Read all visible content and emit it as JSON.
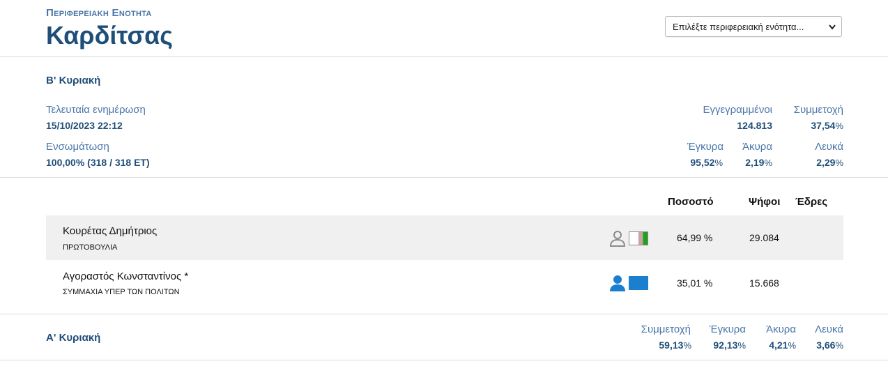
{
  "header": {
    "region_label": "Περιφερειακη Ενοτητα",
    "region_name": "Καρδίτσας",
    "select_placeholder": "Επιλέξτε περιφερειακή ενότητα..."
  },
  "round_b": {
    "title": "Β' Κυριακή",
    "last_update_label": "Τελευταία ενημέρωση",
    "last_update_value": "15/10/2023 22:12",
    "integration_label": "Ενσωμάτωση",
    "integration_value": "100,00% (318 / 318 ΕΤ)",
    "registered_label": "Εγγεγραμμένοι",
    "registered_value": "124.813",
    "turnout_label": "Συμμετοχή",
    "turnout_value": "37,54",
    "valid_label": "Έγκυρα",
    "valid_value": "95,52",
    "invalid_label": "Άκυρα",
    "invalid_value": "2,19",
    "blank_label": "Λευκά",
    "blank_value": "2,29",
    "pct_sign": "%"
  },
  "table": {
    "col_percent": "Ποσοστό",
    "col_votes": "Ψήφοι",
    "col_seats": "Έδρες",
    "rows": [
      {
        "name": "Κουρέτας Δημήτριος",
        "party": "ΠΡΩΤΟΒΟΥΛΙΑ",
        "percent": "64,99 %",
        "votes": "29.084",
        "seats": "",
        "icon_color": "#8a8a8a"
      },
      {
        "name": "Αγοραστός Κωνσταντίνος *",
        "party": "ΣΥΜΜΑΧΙΑ ΥΠΕΡ ΤΩΝ ΠΟΛΙΤΩΝ",
        "percent": "35,01 %",
        "votes": "15.668",
        "seats": "",
        "icon_color": "#1b7fd0"
      }
    ]
  },
  "round_a": {
    "title": "Α' Κυριακή",
    "turnout_label": "Συμμετοχή",
    "turnout_value": "59,13",
    "valid_label": "Έγκυρα",
    "valid_value": "92,13",
    "invalid_label": "Άκυρα",
    "invalid_value": "4,21",
    "blank_label": "Λευκά",
    "blank_value": "3,66",
    "pct_sign": "%"
  }
}
